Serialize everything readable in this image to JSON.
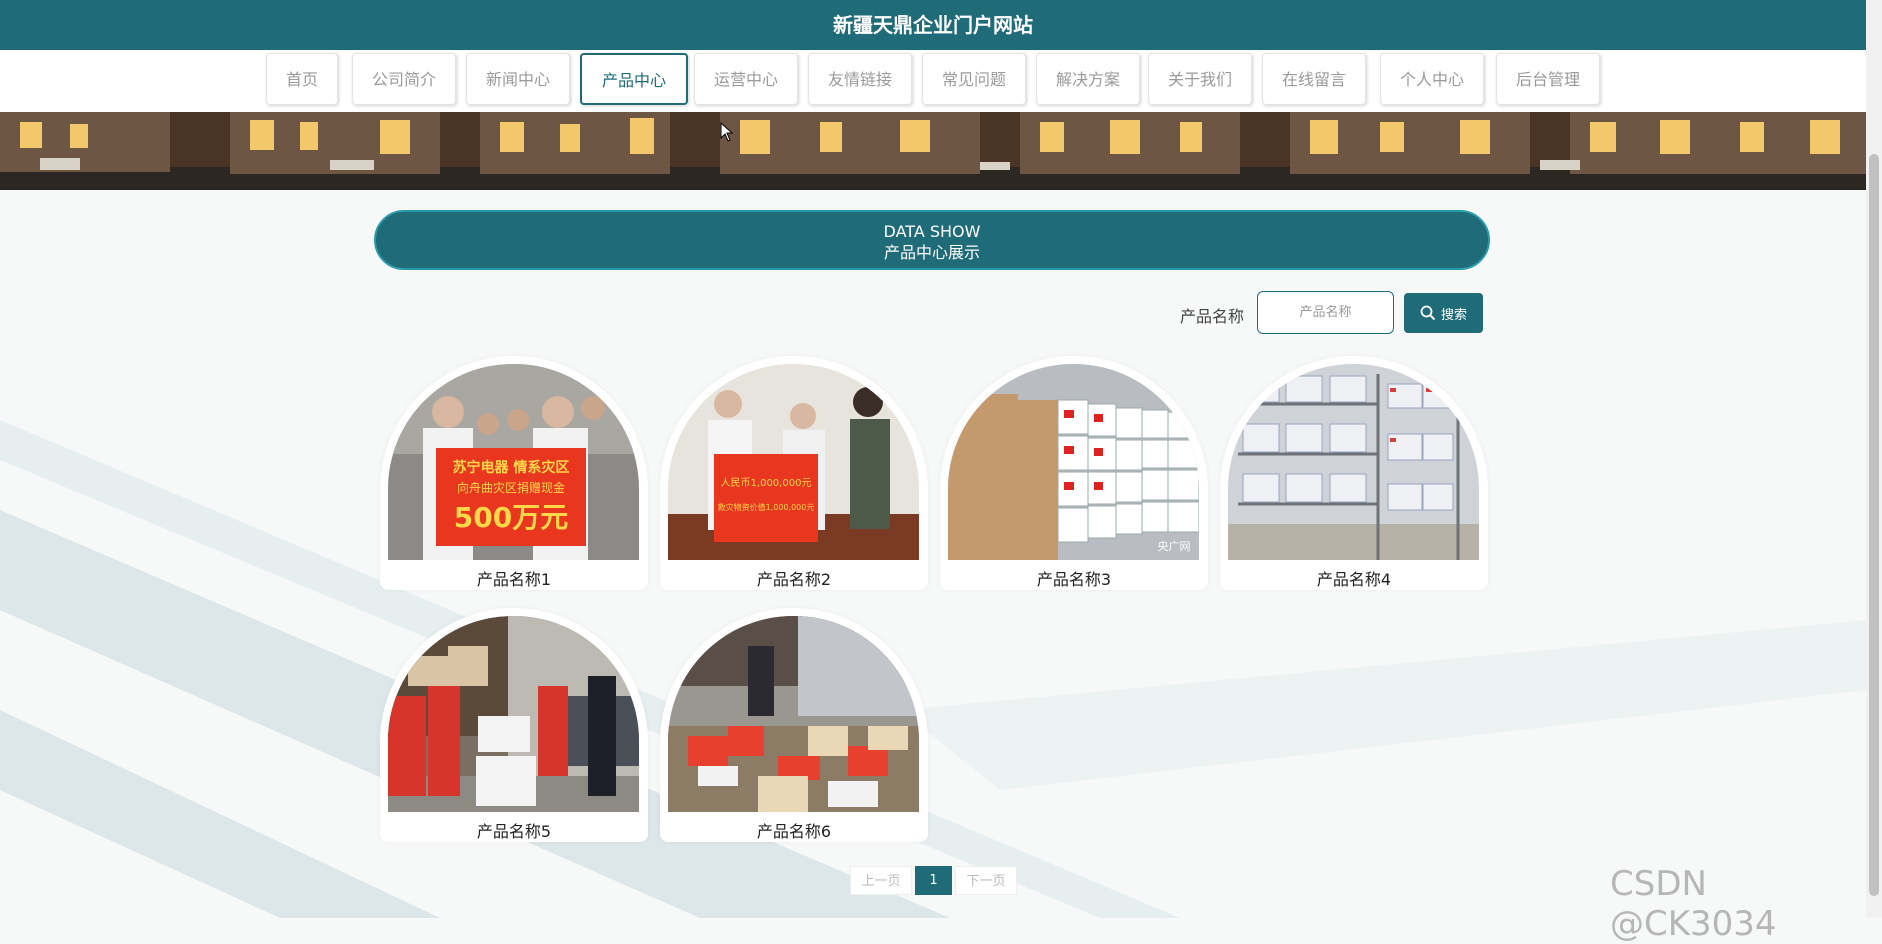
{
  "site": {
    "title": "新疆天鼎企业门户网站"
  },
  "nav": {
    "items": [
      {
        "label": "首页"
      },
      {
        "label": "公司简介"
      },
      {
        "label": "新闻中心"
      },
      {
        "label": "产品中心",
        "active": true
      },
      {
        "label": "运营中心"
      },
      {
        "label": "友情链接"
      },
      {
        "label": "常见问题"
      },
      {
        "label": "解决方案"
      },
      {
        "label": "关于我们"
      },
      {
        "label": "在线留言"
      },
      {
        "label": "个人中心"
      },
      {
        "label": "后台管理"
      }
    ]
  },
  "section": {
    "title_en": "DATA SHOW",
    "title_cn": "产品中心展示"
  },
  "search": {
    "label": "产品名称",
    "placeholder": "产品名称",
    "button_label": "搜索"
  },
  "products": [
    {
      "name": "产品名称1",
      "photo_text_line1": "苏宁电器 情系灾区",
      "photo_text_line2": "向舟曲灾区捐赠现金",
      "photo_text_line3": "500万元"
    },
    {
      "name": "产品名称2",
      "photo_text_line1": "人民币1,000,000元",
      "photo_text_line2": "救灾物资价值1,000,000元"
    },
    {
      "name": "产品名称3",
      "photo_text_line1": "央广网"
    },
    {
      "name": "产品名称4"
    },
    {
      "name": "产品名称5"
    },
    {
      "name": "产品名称6"
    }
  ],
  "pagination": {
    "prev": "上一页",
    "current": "1",
    "next": "下一页"
  },
  "watermark": "CSDN @CK3034",
  "colors": {
    "primary": "#1f6b78",
    "accent_border": "#2a9aa8",
    "banner_red": "#e8361f"
  }
}
